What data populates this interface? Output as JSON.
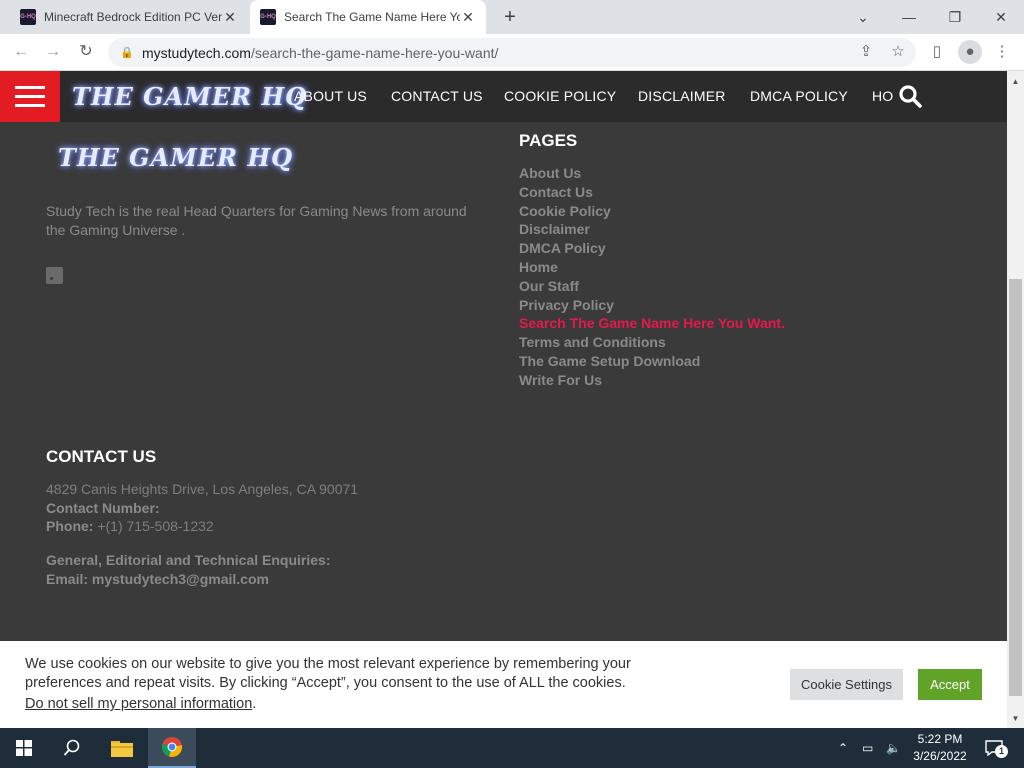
{
  "browser": {
    "tabs": [
      {
        "title": "Minecraft Bedrock Edition PC Ver",
        "active": false
      },
      {
        "title": "Search The Game Name Here Yo",
        "active": true
      }
    ],
    "new_tab_glyph": "+",
    "window_controls": {
      "chevron": "⌄",
      "minimize": "—",
      "restore": "❐",
      "close": "✕"
    },
    "url_domain": "mystudytech.com",
    "url_path": "/search-the-game-name-here-you-want/"
  },
  "site": {
    "logo_text": "THE GAMER HQ",
    "nav_items": [
      "ABOUT US",
      "CONTACT US",
      "COOKIE POLICY",
      "DISCLAIMER",
      "DMCA POLICY",
      "HO"
    ],
    "about_text": "Study Tech is the real Head Quarters for Gaming News from around the Gaming Universe .",
    "pages_title": "PAGES",
    "pages": [
      "About Us",
      "Contact Us",
      "Cookie Policy",
      "Disclaimer",
      "DMCA Policy",
      "Home",
      "Our Staff",
      "Privacy Policy",
      "Search The Game Name Here You Want.",
      "Terms and Conditions",
      "The Game Setup Download",
      "Write For Us"
    ],
    "current_page": "Search The Game Name Here You Want.",
    "contact_title": "CONTACT US",
    "address": "4829 Canis Heights Drive, Los Angeles, CA 90071",
    "contact_number_label": "Contact Number:",
    "phone_label": "Phone:",
    "phone_value": "+(1) 715-508-1232",
    "enquiries_label": "General, Editorial and Technical Enquiries:",
    "email_label": "Email:",
    "email_value": "mystudytech3@gmail.com"
  },
  "cookie": {
    "text": "We use cookies on our website to give you the most relevant experience by remembering your preferences and repeat visits. By clicking “Accept”, you consent to the use of ALL the cookies.",
    "link_text": "Do not sell my personal information",
    "link_suffix": ".",
    "settings_label": "Cookie Settings",
    "accept_label": "Accept"
  },
  "taskbar": {
    "time": "5:22 PM",
    "date": "3/26/2022",
    "notification_count": "1"
  },
  "colors": {
    "accent_red": "#e31b23",
    "current_page_pink": "#e6194b",
    "accept_green": "#61a229",
    "footer_bg": "#3a3a3a"
  }
}
